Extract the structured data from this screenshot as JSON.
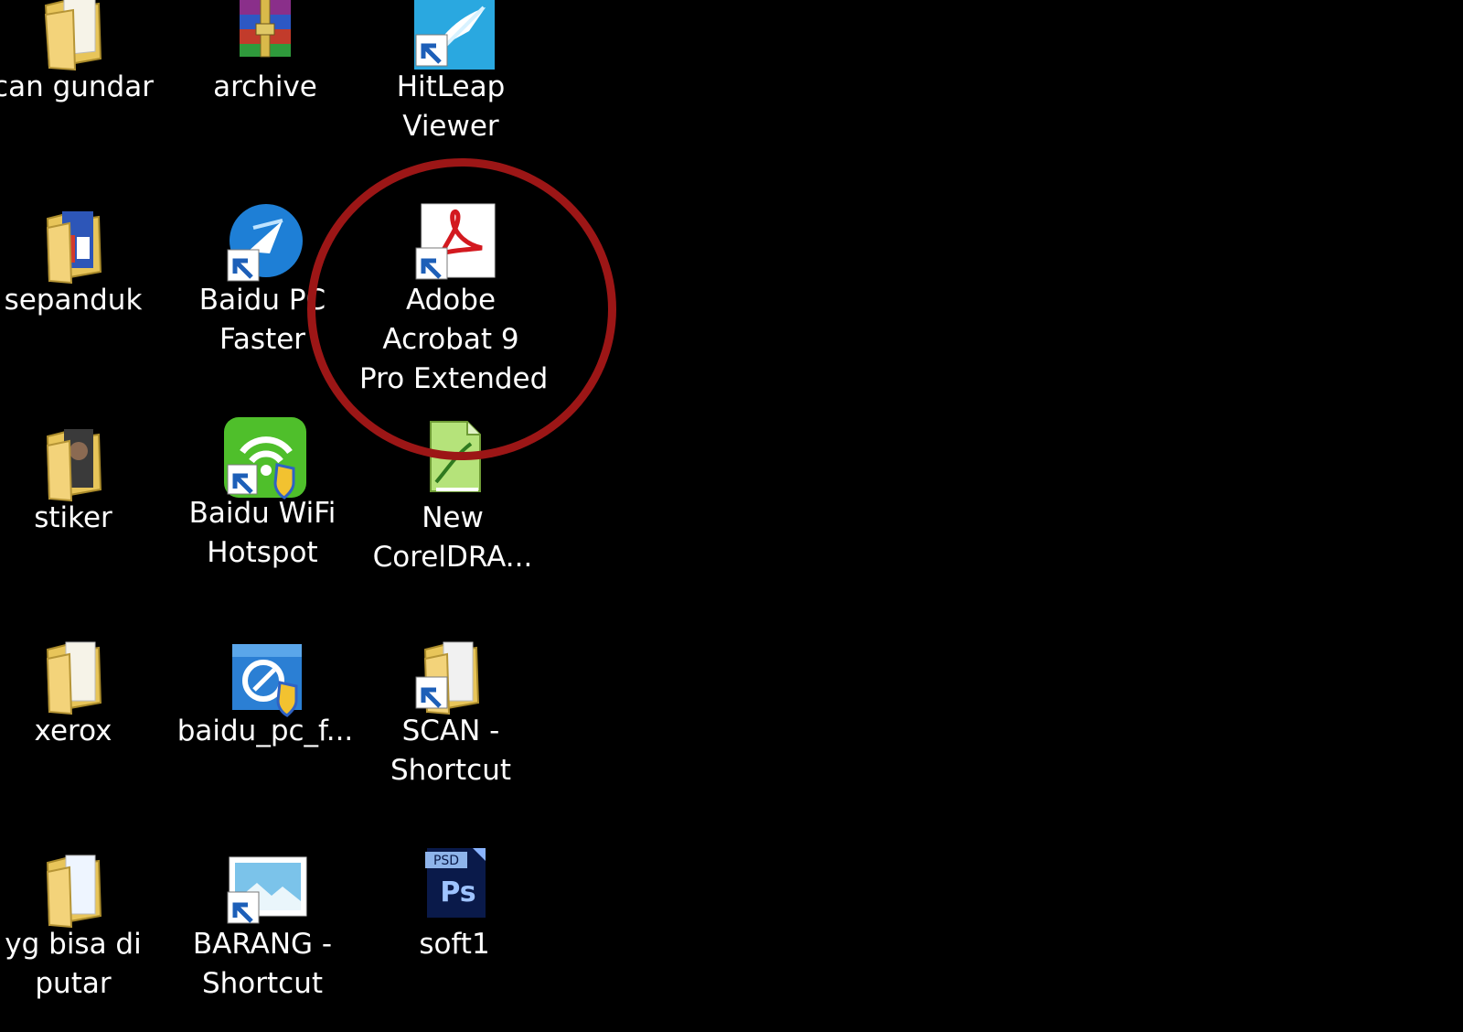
{
  "desktop": {
    "background_color": "#000000",
    "highlight_color": "#9c1616",
    "icons": [
      {
        "id": "scan-gundar",
        "lines": [
          "can gundar"
        ],
        "icon": "folder-icon"
      },
      {
        "id": "archive",
        "lines": [
          "archive"
        ],
        "icon": "winrar-archive-icon"
      },
      {
        "id": "hitleap-viewer",
        "lines": [
          "HitLeap",
          "Viewer"
        ],
        "icon": "hitleap-shortcut-icon"
      },
      {
        "id": "sepanduk",
        "lines": [
          "sepanduk"
        ],
        "icon": "folder-icon"
      },
      {
        "id": "baidu-pc-faster",
        "lines": [
          "Baidu PC",
          "Faster"
        ],
        "icon": "baidu-pc-faster-shortcut-icon"
      },
      {
        "id": "adobe-acrobat",
        "lines": [
          "Adobe",
          "Acrobat 9",
          "Pro Extended"
        ],
        "icon": "adobe-acrobat-shortcut-icon"
      },
      {
        "id": "stiker",
        "lines": [
          "stiker"
        ],
        "icon": "folder-icon"
      },
      {
        "id": "baidu-wifi-hotspot",
        "lines": [
          "Baidu WiFi",
          "Hotspot"
        ],
        "icon": "baidu-wifi-shortcut-icon"
      },
      {
        "id": "new-coreldraw",
        "lines": [
          "New",
          "CorelDRA..."
        ],
        "icon": "coreldraw-file-icon"
      },
      {
        "id": "xerox",
        "lines": [
          "xerox"
        ],
        "icon": "folder-icon"
      },
      {
        "id": "baidu-pc-f",
        "lines": [
          "baidu_pc_f..."
        ],
        "icon": "baidu-installer-shortcut-icon"
      },
      {
        "id": "scan-shortcut",
        "lines": [
          "SCAN -",
          "Shortcut"
        ],
        "icon": "folder-shortcut-icon"
      },
      {
        "id": "yg-bisa-di-putar",
        "lines": [
          "yg bisa di",
          "putar"
        ],
        "icon": "folder-icon"
      },
      {
        "id": "barang-shortcut",
        "lines": [
          "BARANG -",
          "Shortcut"
        ],
        "icon": "image-shortcut-icon"
      },
      {
        "id": "soft1",
        "lines": [
          "soft1"
        ],
        "icon": "photoshop-psd-file-icon",
        "badge": "PSD",
        "mark": "Ps"
      }
    ]
  }
}
